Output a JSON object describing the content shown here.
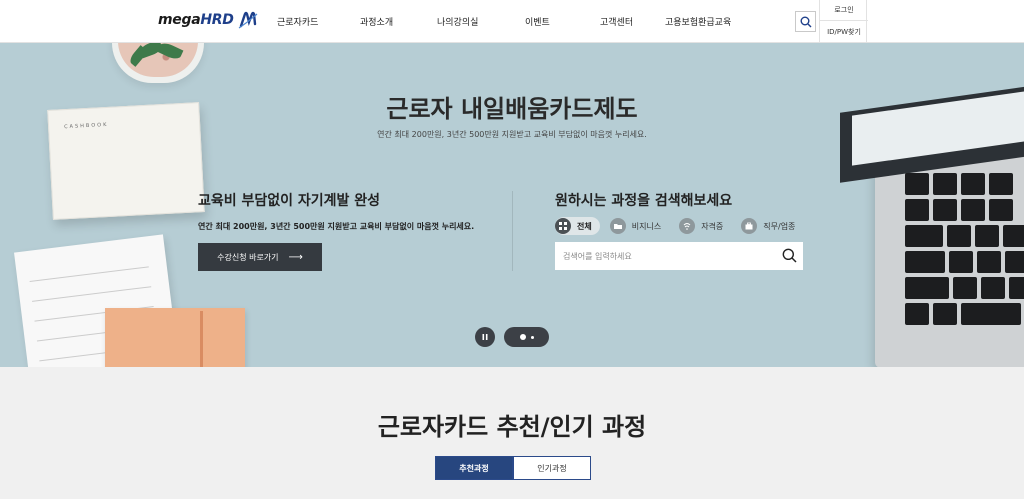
{
  "header": {
    "logo": {
      "text_main": "mega",
      "text_accent": "HRD"
    },
    "nav": [
      {
        "label": "근로자카드"
      },
      {
        "label": "과정소개"
      },
      {
        "label": "나의강의실"
      },
      {
        "label": "이벤트"
      },
      {
        "label": "고객센터"
      },
      {
        "label": "고용보험환급교육"
      }
    ],
    "search_icon": "search-icon",
    "login_label": "로그인",
    "find_label": "ID/PW찾기"
  },
  "hero": {
    "title": "근로자 내일배움카드제도",
    "subtitle": "연간 최대 200만원, 3년간 500만원 지원받고 교육비 부담없이 마음껏 누리세요.",
    "left": {
      "title": "교육비 부담없이 자기계발 완성",
      "desc": "연간 최대 200만원, 3년간 500만원 지원받고 교육비 부담없이 마음껏 누리세요.",
      "button_label": "수강신청 바로가기",
      "button_arrow": "⟶"
    },
    "right": {
      "title": "원하시는 과정을 검색해보세요",
      "filters": [
        {
          "label": "전체",
          "icon": "grid-icon",
          "active": true
        },
        {
          "label": "비지니스",
          "icon": "folder-icon",
          "active": false
        },
        {
          "label": "자격증",
          "icon": "badge-icon",
          "active": false
        },
        {
          "label": "직무/업종",
          "icon": "briefcase-icon",
          "active": false
        }
      ],
      "search_placeholder": "검색어를 입력하세요"
    },
    "decor": {
      "cashbook_label": "CASHBOOK"
    }
  },
  "recommend": {
    "title_regular": "근로자카드 ",
    "title_bold": "추천/인기 과정",
    "tabs": [
      {
        "label": "추천과정",
        "active": true
      },
      {
        "label": "인기과정",
        "active": false
      }
    ]
  },
  "colors": {
    "hero_bg": "#b6cdd4",
    "primary_navy": "#27467f",
    "dark_button": "#353a40"
  }
}
